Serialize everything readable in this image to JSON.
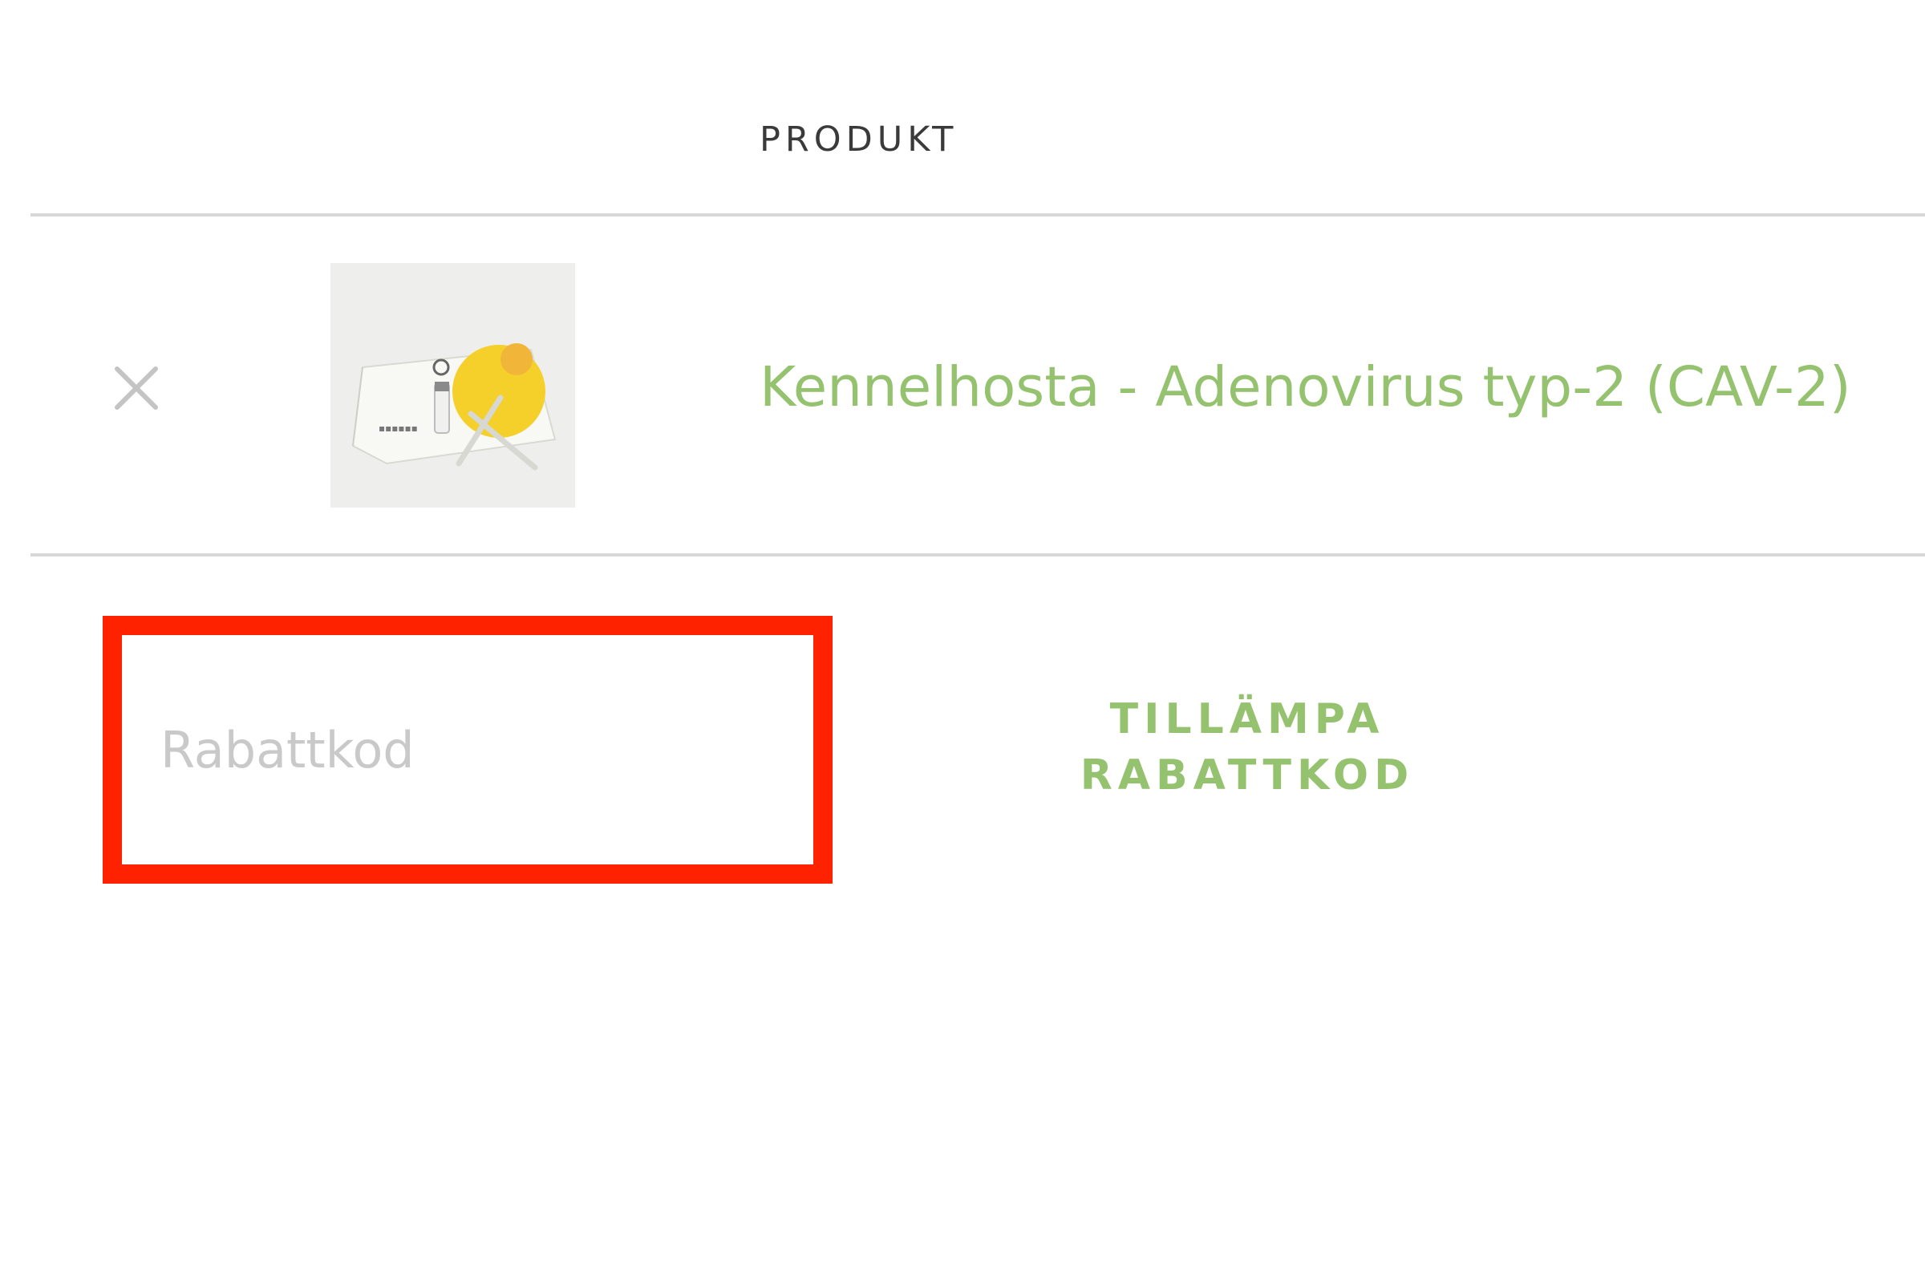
{
  "cart_table": {
    "column_header": "PRODUKT"
  },
  "cart_item": {
    "remove_icon": "close-icon",
    "product_name": "Kennelhosta - Adenovirus typ-2 (CAV-2)",
    "thumbnail_icon": "test-kit-photo"
  },
  "coupon": {
    "placeholder": "Rabattkod",
    "value": "",
    "apply_label_line1": "TILLÄMPA",
    "apply_label_line2": "RABATTKOD"
  },
  "colors": {
    "accent_green": "#95c26f",
    "highlight_red": "#ff2200",
    "divider": "#d7d7d7"
  }
}
